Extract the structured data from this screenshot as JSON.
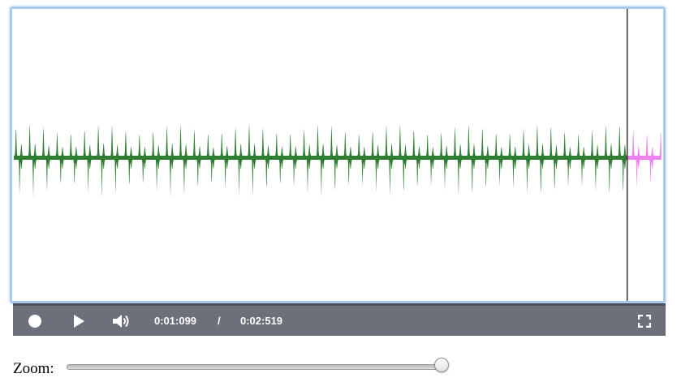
{
  "waveform": {
    "played_color": "#2e7d32",
    "unplayed_color": "#ee82ee",
    "cursor_color": "#333333",
    "playhead_fraction": 0.947
  },
  "player": {
    "record_icon": "record-icon",
    "play_icon": "play-icon",
    "volume_icon": "volume-icon",
    "fullscreen_icon": "fullscreen-icon",
    "current_time": "0:01:099",
    "separator": "/",
    "total_time": "0:02:519"
  },
  "zoom": {
    "label": "Zoom:",
    "value_fraction": 1.0
  }
}
